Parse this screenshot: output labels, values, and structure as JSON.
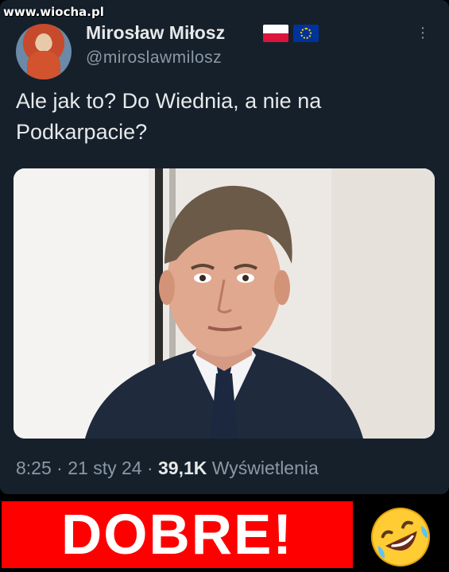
{
  "watermark": "www.wiocha.pl",
  "tweet": {
    "author_name": "Mirosław Miłosz",
    "author_handle": "@miroslawmilosz",
    "flags": [
      "poland-flag-icon",
      "eu-flag-icon"
    ],
    "text": "Ale jak to? Do Wiednia, a nie na Podkarpacie?",
    "time": "8:25",
    "separator": "·",
    "date": "21 sty 24",
    "views_count": "39,1K",
    "views_label": "Wyświetlenia",
    "photo_description_icon": "portrait-photo"
  },
  "banner": {
    "text": "DOBRE!",
    "emoji_icon": "rolling-on-floor-laughing-emoji",
    "color": "#ff0000"
  },
  "colors": {
    "background": "#15202b",
    "primary_text": "#e7e9ea",
    "secondary_text": "#8b98a5"
  }
}
